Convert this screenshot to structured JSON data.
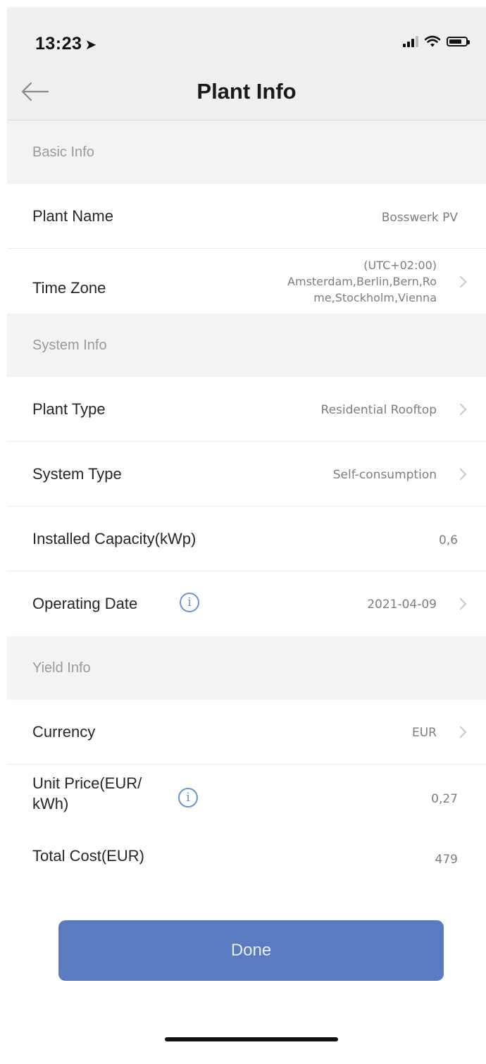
{
  "status_bar": {
    "time": "13:23",
    "location_icon": "location-arrow-icon",
    "signal_icon": "cellular-signal-icon",
    "wifi_icon": "wifi-icon",
    "battery_icon": "battery-icon"
  },
  "nav": {
    "back_icon": "arrow-left-icon",
    "title": "Plant Info"
  },
  "sections": {
    "basic": "Basic Info",
    "system": "System Info",
    "yield": "Yield Info"
  },
  "basic_info": {
    "plant_name_label": "Plant Name",
    "plant_name_value": "Bosswerk PV",
    "time_zone_label": "Time Zone",
    "time_zone_line1": "(UTC+02:00)",
    "time_zone_line2": "Amsterdam,Berlin,Bern,Ro",
    "time_zone_line3": "me,Stockholm,Vienna"
  },
  "system_info": {
    "plant_type_label": "Plant Type",
    "plant_type_value": "Residential Rooftop",
    "system_type_label": "System Type",
    "system_type_value": "Self-consumption",
    "capacity_label": "Installed Capacity(kWp)",
    "capacity_value": "0,6",
    "operating_date_label": "Operating Date",
    "operating_date_value": "2021-04-09"
  },
  "yield_info": {
    "currency_label": "Currency",
    "currency_value": "EUR",
    "unit_price_label_line1": "Unit Price(EUR/",
    "unit_price_label_line2": "kWh)",
    "unit_price_value": "0,27",
    "total_cost_label": "Total Cost(EUR)",
    "total_cost_value": "479"
  },
  "info_icon_glyph": "i",
  "done_label": "Done",
  "colors": {
    "primary_button": "#5a7bbf",
    "info_icon": "#6d93cc",
    "header_bg": "#efefef"
  }
}
